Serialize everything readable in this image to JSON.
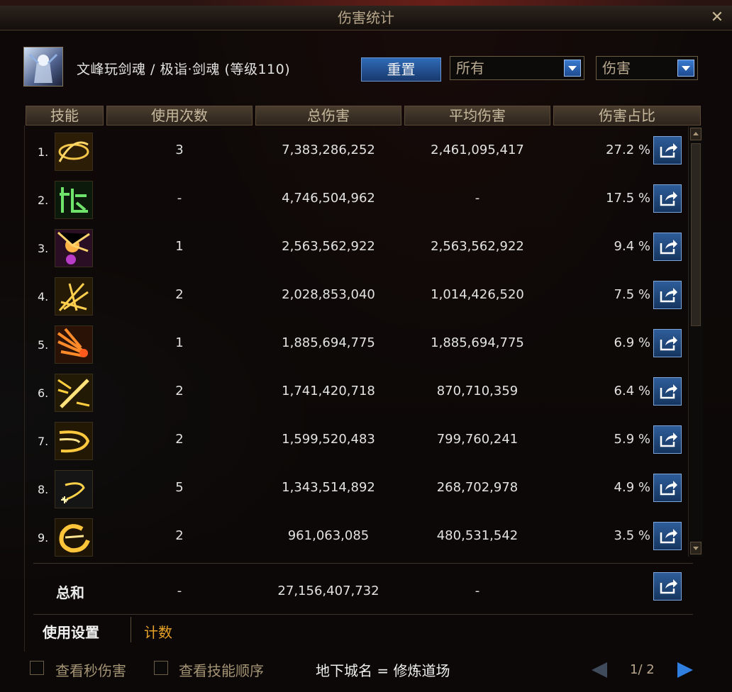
{
  "window": {
    "title": "伤害统计"
  },
  "character": {
    "line": "文峰玩剑魂 / 极诣·剑魂 (等级110)"
  },
  "controls": {
    "reset_label": "重置",
    "filter_value": "所有",
    "mode_value": "伤害"
  },
  "columns": {
    "skill": "技能",
    "uses": "使用次数",
    "total": "总伤害",
    "avg": "平均伤害",
    "pct": "伤害占比"
  },
  "rows": [
    {
      "rank": "1.",
      "uses": "3",
      "total": "7,383,286,252",
      "avg": "2,461,095,417",
      "pct": "27.2 %"
    },
    {
      "rank": "2.",
      "uses": "-",
      "total": "4,746,504,962",
      "avg": "-",
      "pct": "17.5 %"
    },
    {
      "rank": "3.",
      "uses": "1",
      "total": "2,563,562,922",
      "avg": "2,563,562,922",
      "pct": "9.4 %"
    },
    {
      "rank": "4.",
      "uses": "2",
      "total": "2,028,853,040",
      "avg": "1,014,426,520",
      "pct": "7.5 %"
    },
    {
      "rank": "5.",
      "uses": "1",
      "total": "1,885,694,775",
      "avg": "1,885,694,775",
      "pct": "6.9 %"
    },
    {
      "rank": "6.",
      "uses": "2",
      "total": "1,741,420,718",
      "avg": "870,710,359",
      "pct": "6.4 %"
    },
    {
      "rank": "7.",
      "uses": "2",
      "total": "1,599,520,483",
      "avg": "799,760,241",
      "pct": "5.9 %"
    },
    {
      "rank": "8.",
      "uses": "5",
      "total": "1,343,514,892",
      "avg": "268,702,978",
      "pct": "4.9 %"
    },
    {
      "rank": "9.",
      "uses": "2",
      "total": "961,063,085",
      "avg": "480,531,542",
      "pct": "3.5 %"
    }
  ],
  "totals": {
    "label": "总和",
    "uses": "-",
    "total": "27,156,407,732",
    "avg": "-"
  },
  "tabs": {
    "settings": "使用设置",
    "count": "计数"
  },
  "footer": {
    "check_dps": "查看秒伤害",
    "check_order": "查看技能顺序",
    "dungeon": "地下城名 = 修炼道场",
    "page": "1/ 2"
  },
  "colors": {
    "accent_blue": "#2f6bb8",
    "tab_active_text": "#e8a227",
    "header_text": "#c7b99d"
  }
}
